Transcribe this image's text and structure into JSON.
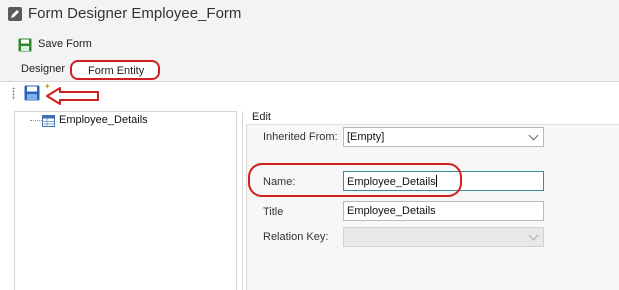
{
  "window": {
    "title": "Form Designer Employee_Form"
  },
  "savebar": {
    "save_label": "Save Form"
  },
  "tabs": [
    {
      "label": "Designer"
    },
    {
      "label": "Form Entity"
    }
  ],
  "tree": {
    "items": [
      {
        "label": "Employee_Details"
      }
    ]
  },
  "edit": {
    "group_label": "Edit",
    "inherited_from": {
      "label": "Inherited From:",
      "value": "[Empty]"
    },
    "name": {
      "label": "Name:",
      "value": "Employee_Details"
    },
    "title": {
      "label": "Title",
      "value": "Employee_Details"
    },
    "relation_key": {
      "label": "Relation Key:",
      "value": ""
    }
  },
  "colors": {
    "annotation_red": "#d11f1f",
    "save_green": "#2d8a2d",
    "save_blue": "#2b63b8"
  }
}
